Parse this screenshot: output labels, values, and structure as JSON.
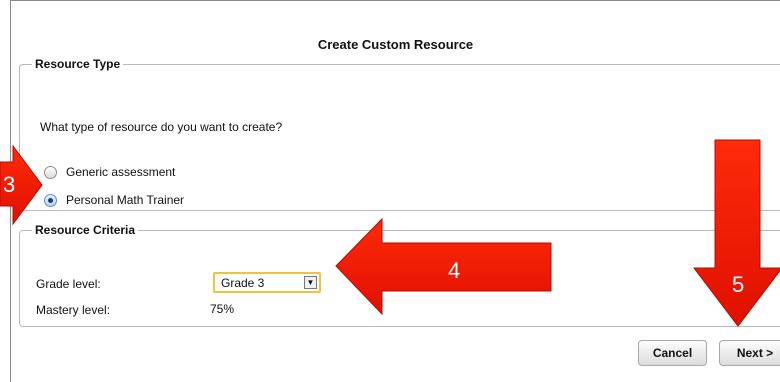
{
  "dialog": {
    "title": "Create Custom Resource",
    "resource_type": {
      "legend": "Resource Type",
      "question": "What type of resource do you want to create?",
      "options": [
        {
          "label": "Generic assessment",
          "selected": false
        },
        {
          "label": "Personal Math Trainer",
          "selected": true
        }
      ]
    },
    "resource_criteria": {
      "legend": "Resource Criteria",
      "grade_label": "Grade level:",
      "grade_value": "Grade 3",
      "mastery_label": "Mastery level:",
      "mastery_value": "75%"
    },
    "buttons": {
      "cancel": "Cancel",
      "next": "Next >"
    }
  },
  "annotations": {
    "step3": "3",
    "step4": "4",
    "step5": "5",
    "arrow_color": "#ff1a00"
  }
}
